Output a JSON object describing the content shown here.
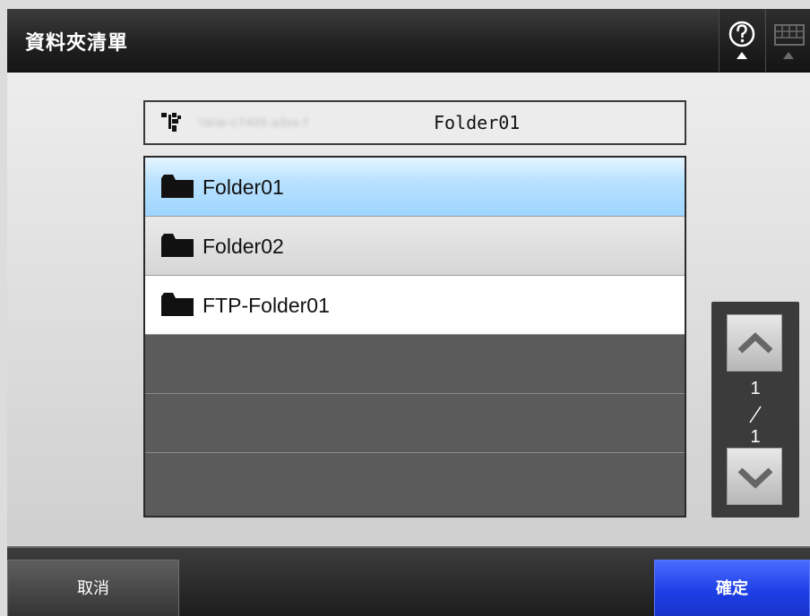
{
  "header": {
    "title": "資料夾清單",
    "help_icon": "question-circle-icon",
    "keyboard_icon": "keyboard-icon"
  },
  "path_bar": {
    "icon": "folder-tree-icon",
    "host": "\\\\kiw-c7405.a3ss.f",
    "folder": "Folder01"
  },
  "folders": [
    {
      "name": "Folder01",
      "icon": "folder-icon",
      "selected": true
    },
    {
      "name": "Folder02",
      "icon": "folder-icon",
      "selected": false
    },
    {
      "name": "FTP-Folder01",
      "icon": "folder-icon",
      "selected": false
    }
  ],
  "pager": {
    "current": "1",
    "total": "1"
  },
  "footer": {
    "cancel_label": "取消",
    "ok_label": "確定"
  },
  "colors": {
    "selected_row": "#b9e2ff",
    "ok_button": "#1f3fe6",
    "header": "#1f1f1f"
  }
}
